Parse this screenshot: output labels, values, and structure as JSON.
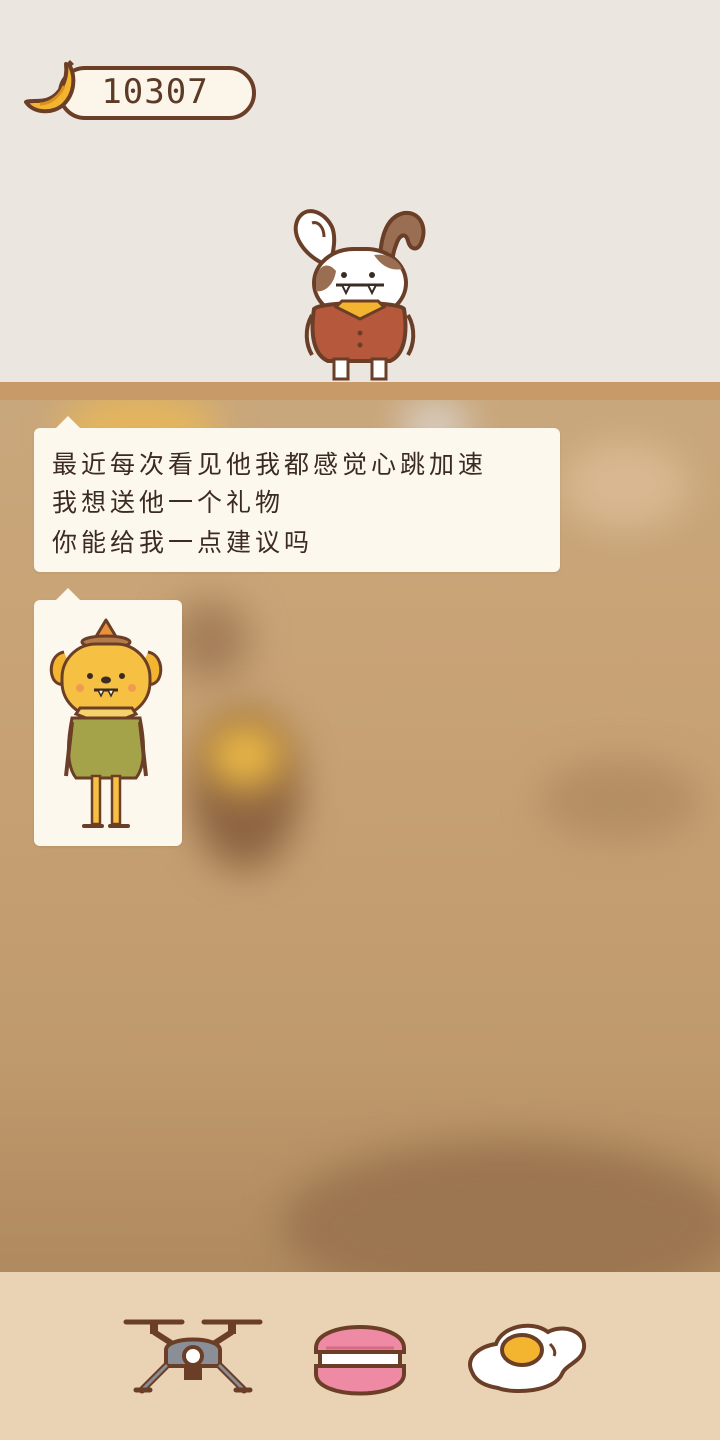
{
  "currency": {
    "amount": "10307",
    "icon": "banana-icon"
  },
  "dialog": {
    "lines": [
      "最近每次看见他我都感觉心跳加速",
      "我想送他一个礼物",
      "你能给我一点建议吗"
    ]
  },
  "characters": {
    "visitor": "bunny-character",
    "subject": "dog-character"
  },
  "items": [
    {
      "name": "drone-item"
    },
    {
      "name": "macaron-item"
    },
    {
      "name": "fried-egg-item"
    }
  ],
  "colors": {
    "outline": "#6b3f27",
    "shelf": "#c79a67",
    "bottom_bar": "#ead3b4",
    "bubble": "#fdf8ee"
  }
}
